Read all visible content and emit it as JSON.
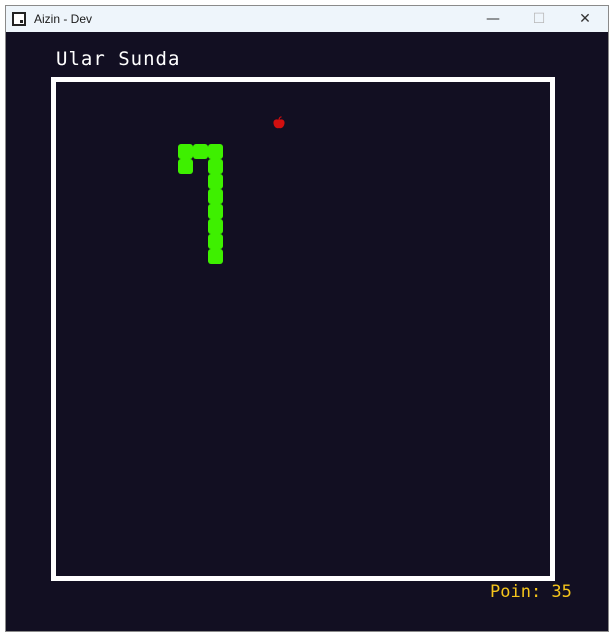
{
  "window": {
    "title": "Aizin - Dev",
    "icon": "app-window-icon",
    "controls": {
      "minimize": "—",
      "maximize": "☐",
      "close": "✕"
    }
  },
  "game": {
    "title": "Ular Sunda",
    "score_text": "Poin: 35",
    "grid_cell": 15,
    "snake_color": "#3ef000",
    "food_color": "#d10f0f",
    "background_color": "#120f22",
    "score_color": "#f5c51b",
    "snake_cells": [
      [
        10,
        11
      ],
      [
        10,
        10
      ],
      [
        10,
        9
      ],
      [
        10,
        8
      ],
      [
        10,
        7
      ],
      [
        10,
        6
      ],
      [
        10,
        5
      ],
      [
        9,
        4
      ],
      [
        10,
        4
      ],
      [
        8,
        4
      ],
      [
        8,
        5
      ]
    ],
    "food_cell": [
      14,
      2
    ]
  }
}
